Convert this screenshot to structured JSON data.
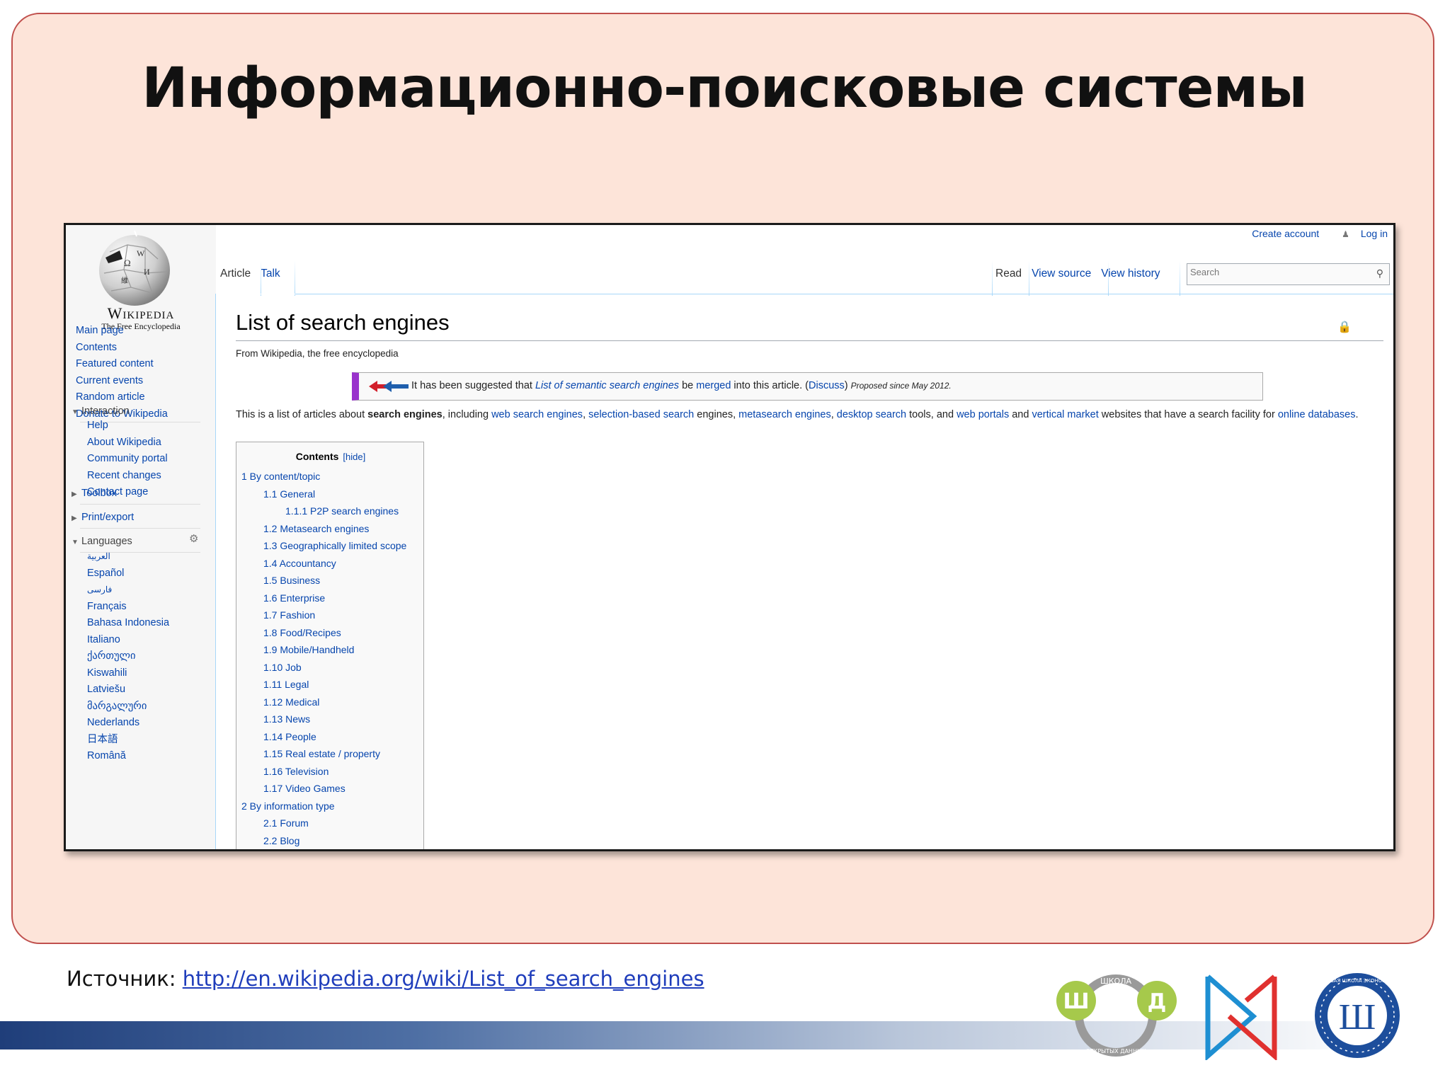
{
  "slide": {
    "title": "Информационно-поисковые системы",
    "source_label": "Источник:",
    "source_url": "http://en.wikipedia.org/wiki/List_of_search_engines"
  },
  "wiki": {
    "logo_word": "Wikipedia",
    "logo_tagline": "The Free Encyclopedia",
    "personal": {
      "create_account": "Create account",
      "log_in": "Log in"
    },
    "tabs_left": [
      "Article",
      "Talk"
    ],
    "tabs_right": [
      "Read",
      "View source",
      "View history"
    ],
    "search_placeholder": "Search",
    "nav": [
      "Main page",
      "Contents",
      "Featured content",
      "Current events",
      "Random article",
      "Donate to Wikipedia"
    ],
    "interaction": {
      "heading": "Interaction",
      "items": [
        "Help",
        "About Wikipedia",
        "Community portal",
        "Recent changes",
        "Contact page"
      ]
    },
    "toolbox": "Toolbox",
    "print_export": "Print/export",
    "languages": {
      "heading": "Languages",
      "items": [
        "العربية",
        "Español",
        "فارسی",
        "Français",
        "Bahasa Indonesia",
        "Italiano",
        "ქართული",
        "Kiswahili",
        "Latviešu",
        "მარგალური",
        "Nederlands",
        "日本語",
        "Română"
      ]
    },
    "page_title": "List of search engines",
    "tagline": "From Wikipedia, the free encyclopedia",
    "merge_notice": {
      "t1": "It has been suggested that ",
      "link1": "List of semantic search engines",
      "t2": " be ",
      "link2": "merged",
      "t3": " into this article. (",
      "link3": "Discuss",
      "t4": ") ",
      "proposed": "Proposed since May 2012."
    },
    "intro": {
      "t1": "This is a list of articles about ",
      "bold": "search engines",
      "t2": ", including ",
      "l1": "web search engines",
      "t3": ", ",
      "l2": "selection-based search",
      "t4": " engines, ",
      "l3": "metasearch engines",
      "t5": ", ",
      "l4": "desktop search",
      "t6": " tools, and ",
      "l5": "web portals",
      "t7": " and ",
      "l6": "vertical market",
      "t8": " websites that have a search facility for ",
      "l7": "online databases",
      "t9": "."
    },
    "toc": {
      "title": "Contents",
      "hide": "[hide]",
      "items": [
        {
          "text": "1 By content/topic",
          "level": 1
        },
        {
          "text": "1.1 General",
          "level": 2
        },
        {
          "text": "1.1.1 P2P search engines",
          "level": 3
        },
        {
          "text": "1.2 Metasearch engines",
          "level": 2
        },
        {
          "text": "1.3 Geographically limited scope",
          "level": 2
        },
        {
          "text": "1.4 Accountancy",
          "level": 2
        },
        {
          "text": "1.5 Business",
          "level": 2
        },
        {
          "text": "1.6 Enterprise",
          "level": 2
        },
        {
          "text": "1.7 Fashion",
          "level": 2
        },
        {
          "text": "1.8 Food/Recipes",
          "level": 2
        },
        {
          "text": "1.9 Mobile/Handheld",
          "level": 2
        },
        {
          "text": "1.10 Job",
          "level": 2
        },
        {
          "text": "1.11 Legal",
          "level": 2
        },
        {
          "text": "1.12 Medical",
          "level": 2
        },
        {
          "text": "1.13 News",
          "level": 2
        },
        {
          "text": "1.14 People",
          "level": 2
        },
        {
          "text": "1.15 Real estate / property",
          "level": 2
        },
        {
          "text": "1.16 Television",
          "level": 2
        },
        {
          "text": "1.17 Video Games",
          "level": 2
        },
        {
          "text": "2 By information type",
          "level": 1
        },
        {
          "text": "2.1 Forum",
          "level": 2
        },
        {
          "text": "2.2 Blog",
          "level": 2
        }
      ]
    }
  },
  "logos": {
    "shad_letters": [
      "Ш",
      "Д"
    ],
    "shad_top": "ШКОЛА",
    "shad_bottom": "ОТКРЫТЫХ ДАННЫХ",
    "hse_letter": "Ш",
    "hse_ring": "ВЫСШАЯ ШКОЛА ЭКОНОМИКИ"
  },
  "colors": {
    "frame": "#c0504d",
    "slide_bg": "#fde4d9",
    "link": "#0645ad",
    "shad_green": "#a6c94b",
    "dn_blue": "#1e8fd2",
    "dn_red": "#e0312f",
    "hse_blue": "#1d4e9c"
  }
}
